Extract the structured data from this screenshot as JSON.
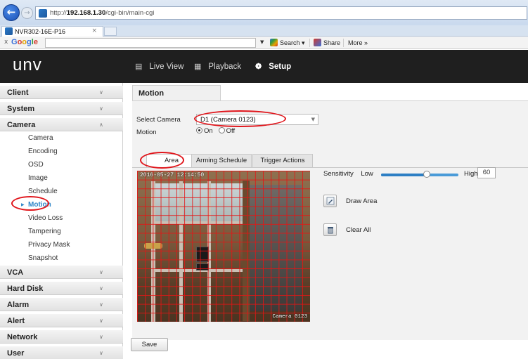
{
  "browser": {
    "url_prefix": "http://",
    "url_host": "192.168.1.30",
    "url_path": "/cgi-bin/main-cgi",
    "tab_title": "NVR302-16E-P16",
    "tab_close": "×",
    "toolbar_close": "x",
    "search_label": "Search",
    "share_label": "Share",
    "more_label": "More »"
  },
  "app": {
    "brand": "UNV",
    "nav": [
      {
        "label": "Live View"
      },
      {
        "label": "Playback"
      },
      {
        "label": "Setup"
      }
    ]
  },
  "sidebar": {
    "sections": [
      {
        "label": "Client"
      },
      {
        "label": "System"
      },
      {
        "label": "Camera"
      },
      {
        "label": "VCA"
      },
      {
        "label": "Hard Disk"
      },
      {
        "label": "Alarm"
      },
      {
        "label": "Alert"
      },
      {
        "label": "Network"
      },
      {
        "label": "User"
      }
    ],
    "camera_items": [
      "Camera",
      "Encoding",
      "OSD",
      "Image",
      "Schedule",
      "Motion",
      "Video Loss",
      "Tampering",
      "Privacy Mask",
      "Snapshot"
    ]
  },
  "main": {
    "title": "Motion",
    "select_camera_label": "Select Camera",
    "select_camera_value": "D1 (Camera 0123)",
    "motion_label": "Motion",
    "motion_on": "On",
    "motion_off": "Off",
    "motion_value": "On",
    "tabs": [
      "Area",
      "Arming Schedule",
      "Trigger Actions"
    ],
    "video_timestamp": "2016-05-27 12:14:50",
    "video_camera_label": "Camera 0123",
    "sensitivity_label": "Sensitivity",
    "sensitivity_low": "Low",
    "sensitivity_high": "High",
    "sensitivity_value": "60",
    "draw_area_label": "Draw Area",
    "clear_all_label": "Clear All",
    "save_label": "Save"
  },
  "colors": {
    "header_bg": "#1f1f1f",
    "accent": "#2f86c9",
    "annotation": "#e0151b",
    "motion_grid": "#e61414"
  }
}
